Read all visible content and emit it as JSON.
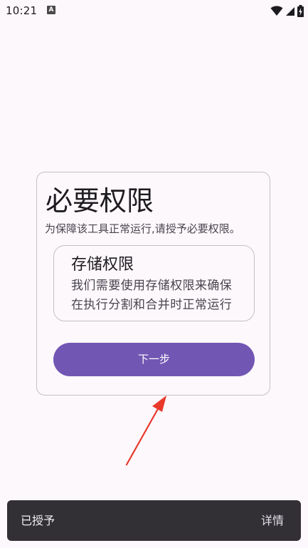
{
  "status_bar": {
    "time": "10:21",
    "icons": [
      "accessibility-a-icon",
      "wifi-icon",
      "cell-signal-icon",
      "battery-charging-icon"
    ],
    "a_glyph": "A"
  },
  "dialog": {
    "title": "必要权限",
    "subtitle": "为保障该工具正常运行,请授予必要权限。",
    "permission": {
      "title": "存储权限",
      "description": "我们需要使用存储权限来确保在执行分割和合并时正常运行"
    },
    "next_button_label": "下一步"
  },
  "snackbar": {
    "message": "已授予",
    "action_label": "详情"
  },
  "colors": {
    "background": "#fdf8fc",
    "primary_button": "#7256b3",
    "snackbar": "#323035",
    "annotation_arrow": "#e8392b"
  }
}
